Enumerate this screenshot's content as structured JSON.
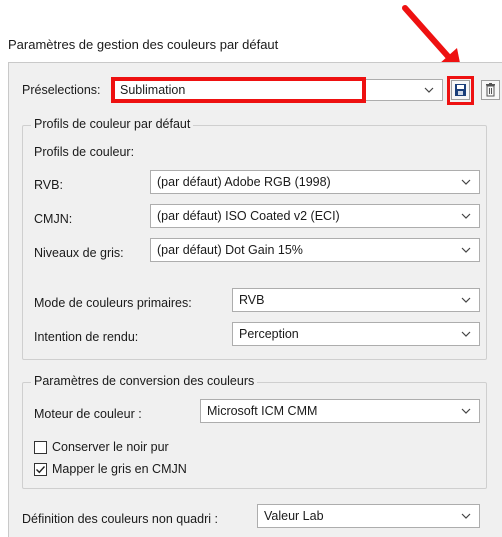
{
  "window_title": "Paramètres de gestion des couleurs par défaut",
  "presets": {
    "label": "Préselections:",
    "value": "Sublimation"
  },
  "icons": {
    "save": "save-disk-icon",
    "delete": "trash-icon",
    "arrow": "red-arrow-icon"
  },
  "profiles_group": {
    "title": "Profils de couleur par défaut",
    "subtitle": "Profils de couleur:",
    "rgb": {
      "label": "RVB:",
      "value": "(par défaut) Adobe RGB (1998)"
    },
    "cmyk": {
      "label": "CMJN:",
      "value": "(par défaut) ISO Coated v2 (ECI)"
    },
    "gray": {
      "label": "Niveaux de gris:",
      "value": "(par défaut) Dot Gain 15%"
    },
    "primary_mode": {
      "label": "Mode de couleurs primaires:",
      "value": "RVB"
    },
    "rendering_intent": {
      "label": "Intention de rendu:",
      "value": "Perception"
    }
  },
  "conversion_group": {
    "title": "Paramètres de conversion des couleurs",
    "engine": {
      "label": "Moteur de couleur :",
      "value": "Microsoft ICM CMM"
    },
    "keep_black": {
      "label": "Conserver le noir pur",
      "checked": false
    },
    "map_gray": {
      "label": "Mapper le gris en CMJN",
      "checked": true
    }
  },
  "spot_colors": {
    "label": "Définition des couleurs non quadri :",
    "value": "Valeur Lab"
  },
  "colors": {
    "highlight": "#ee1111",
    "panel_bg": "#f0f0f0"
  }
}
